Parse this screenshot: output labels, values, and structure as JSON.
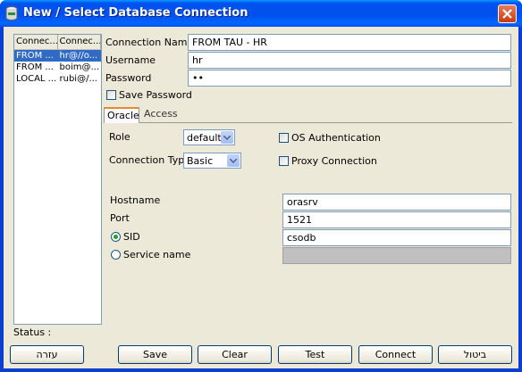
{
  "window": {
    "title": "New / Select Database Connection"
  },
  "connections": {
    "headers": [
      "Connec...",
      "Connec..."
    ],
    "rows": [
      {
        "name": "FROM ...",
        "detail": "hr@//o..."
      },
      {
        "name": "FROM ...",
        "detail": "boim@..."
      },
      {
        "name": "LOCAL ...",
        "detail": "rubi@/..."
      }
    ]
  },
  "form": {
    "connection_name_label": "Connection Name",
    "connection_name_value": "FROM TAU - HR",
    "username_label": "Username",
    "username_value": "hr",
    "password_label": "Password",
    "password_value": "••",
    "save_password_label": "Save Password"
  },
  "tabs": {
    "oracle": "Oracle",
    "access": "Access"
  },
  "oracle": {
    "role_label": "Role",
    "role_value": "default",
    "connection_type_label": "Connection Type",
    "connection_type_value": "Basic",
    "os_auth_label": "OS Authentication",
    "proxy_label": "Proxy Connection",
    "hostname_label": "Hostname",
    "hostname_value": "orasrv",
    "port_label": "Port",
    "port_value": "1521",
    "sid_label": "SID",
    "sid_value": "csodb",
    "service_label": "Service name"
  },
  "status_label": "Status :",
  "buttons": {
    "help": "עזרה",
    "save": "Save",
    "clear": "Clear",
    "test": "Test",
    "connect": "Connect",
    "cancel": "ביטול"
  },
  "colors": {
    "selection": "#316ac5",
    "dialog": "#ece9d8",
    "titlebar": "#0053ee"
  }
}
